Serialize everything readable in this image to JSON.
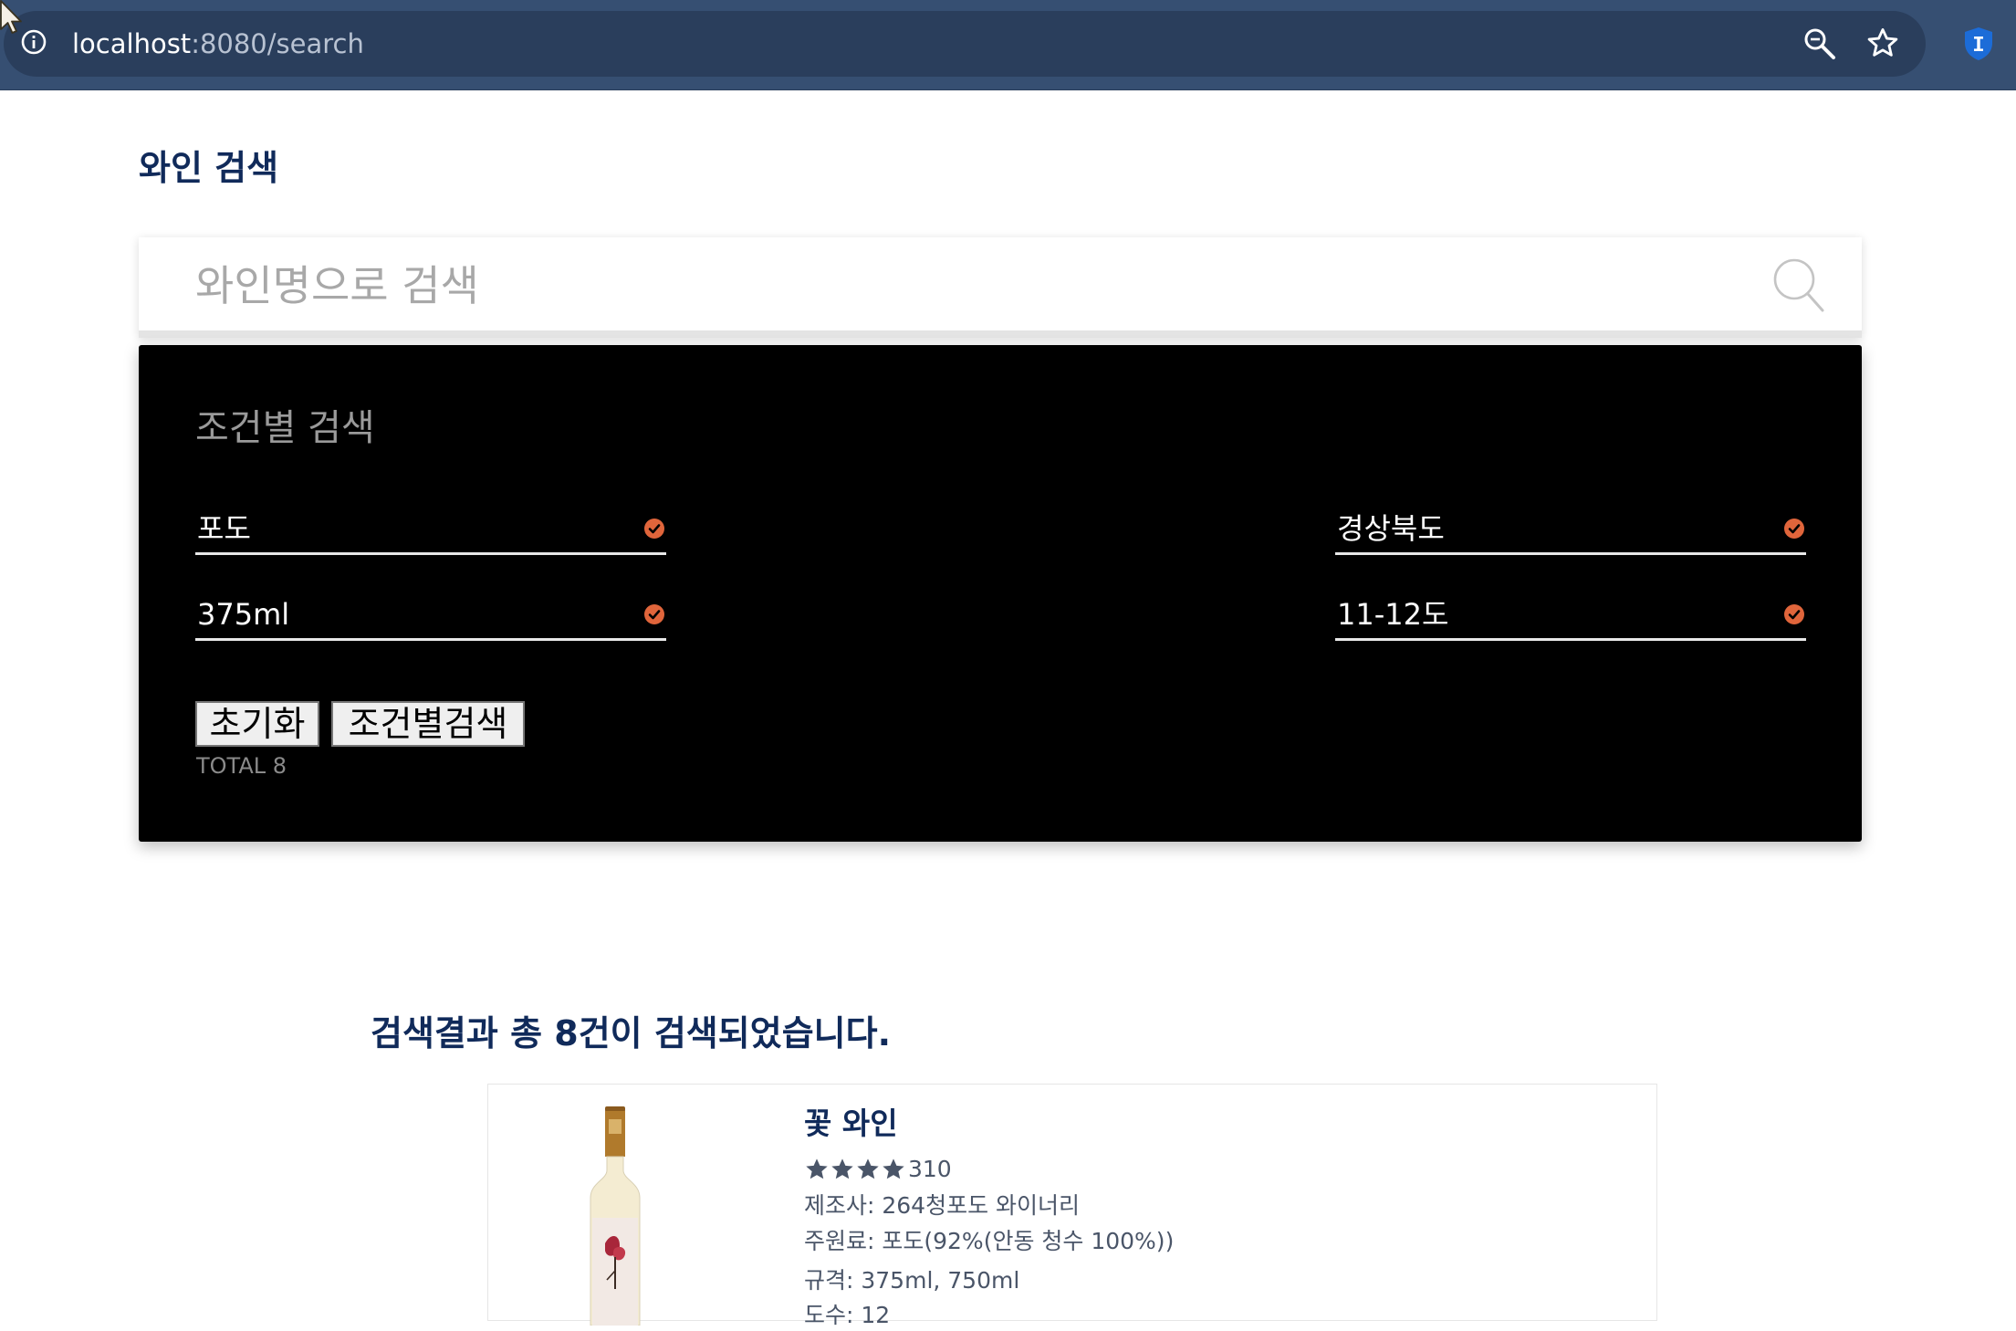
{
  "browser": {
    "url_host": "localhost",
    "url_path": ":8080/search"
  },
  "page": {
    "title": "와인 검색"
  },
  "search": {
    "placeholder": "와인명으로 검색"
  },
  "filter": {
    "title": "조건별 검색",
    "fields": [
      {
        "value": "포도"
      },
      {
        "value": "경상북도"
      },
      {
        "value": "375ml"
      },
      {
        "value": "11-12도"
      }
    ],
    "reset_label": "초기화",
    "search_label": "조건별검색",
    "total_label": "TOTAL 8",
    "accent_color": "#e0653b"
  },
  "results": {
    "heading": "검색결과 총 8건이 검색되었습니다.",
    "items": [
      {
        "name": "꽃 와인",
        "stars": 4,
        "rating_count": "310",
        "manufacturer": "제조사: 264청포도 와이너리",
        "ingredients": "주원료: 포도(92%(안동 청수 100%))",
        "volume": "규격: 375ml, 750ml",
        "abv_partial": "도수: 12"
      }
    ]
  }
}
